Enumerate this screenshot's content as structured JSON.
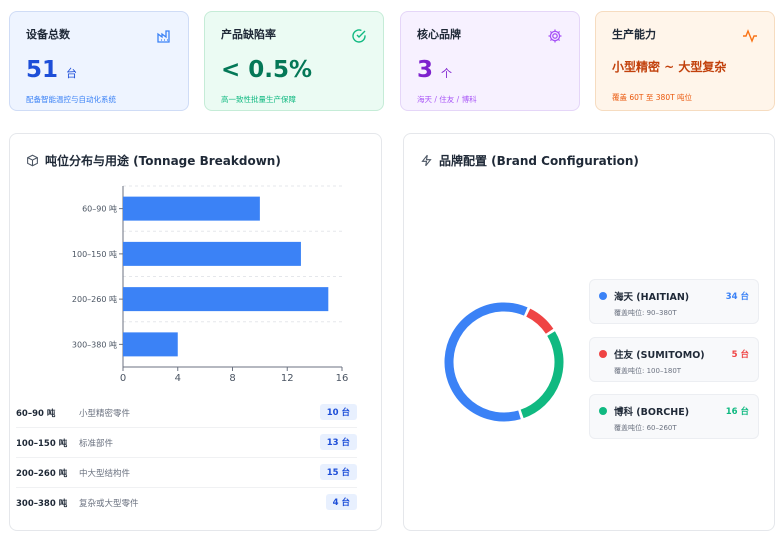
{
  "stats": {
    "devices": {
      "title": "设备总数",
      "value": "51",
      "unit": "台",
      "sub": "配备智能温控与自动化系统",
      "icon": "factory-icon"
    },
    "defect": {
      "title": "产品缺陷率",
      "value": "< 0.5%",
      "sub": "高一致性批量生产保障",
      "icon": "check-circle-icon"
    },
    "brands": {
      "title": "核心品牌",
      "value": "3",
      "unit": "个",
      "sub": "海天 / 住友 / 博科",
      "icon": "gear-icon"
    },
    "capacity": {
      "title": "生产能力",
      "value": "小型精密 ~ 大型复杂",
      "sub": "覆盖 60T 至 380T 吨位",
      "icon": "activity-icon"
    }
  },
  "tonnage": {
    "title": "吨位分布与用途 (Tonnage Breakdown)",
    "icon": "cube-icon",
    "rows": [
      {
        "range": "60–90 吨",
        "usage": "小型精密零件",
        "count": "10 台"
      },
      {
        "range": "100–150 吨",
        "usage": "标准部件",
        "count": "13 台"
      },
      {
        "range": "200–260 吨",
        "usage": "中大型结构件",
        "count": "15 台"
      },
      {
        "range": "300–380 吨",
        "usage": "复杂或大型零件",
        "count": "4 台"
      }
    ]
  },
  "chart_data": {
    "type": "bar",
    "orientation": "horizontal",
    "categories": [
      "60–90 吨",
      "100–150 吨",
      "200–260 吨",
      "300–380 吨"
    ],
    "values": [
      10,
      13,
      15,
      4
    ],
    "xlim": [
      0,
      16
    ],
    "xticks": [
      "0",
      "4",
      "8",
      "12",
      "16"
    ],
    "grid": true,
    "bar_color": "#3b82f6"
  },
  "brand_config": {
    "title": "品牌配置 (Brand Configuration)",
    "icon": "lightning-icon",
    "donut": {
      "type": "pie",
      "variant": "donut",
      "labels": [
        "海天 (HAITIAN)",
        "住友 (SUMITOMO)",
        "博科 (BORCHE)"
      ],
      "values": [
        34,
        5,
        16
      ],
      "colors": [
        "#3b82f6",
        "#ef4444",
        "#10b981"
      ]
    },
    "items": [
      {
        "name": "海天 (HAITIAN)",
        "count": "34 台",
        "range": "覆盖吨位: 90–380T",
        "color": "#3b82f6"
      },
      {
        "name": "住友 (SUMITOMO)",
        "count": "5 台",
        "range": "覆盖吨位: 100–180T",
        "color": "#ef4444"
      },
      {
        "name": "博科 (BORCHE)",
        "count": "16 台",
        "range": "覆盖吨位: 60–260T",
        "color": "#10b981"
      }
    ]
  }
}
